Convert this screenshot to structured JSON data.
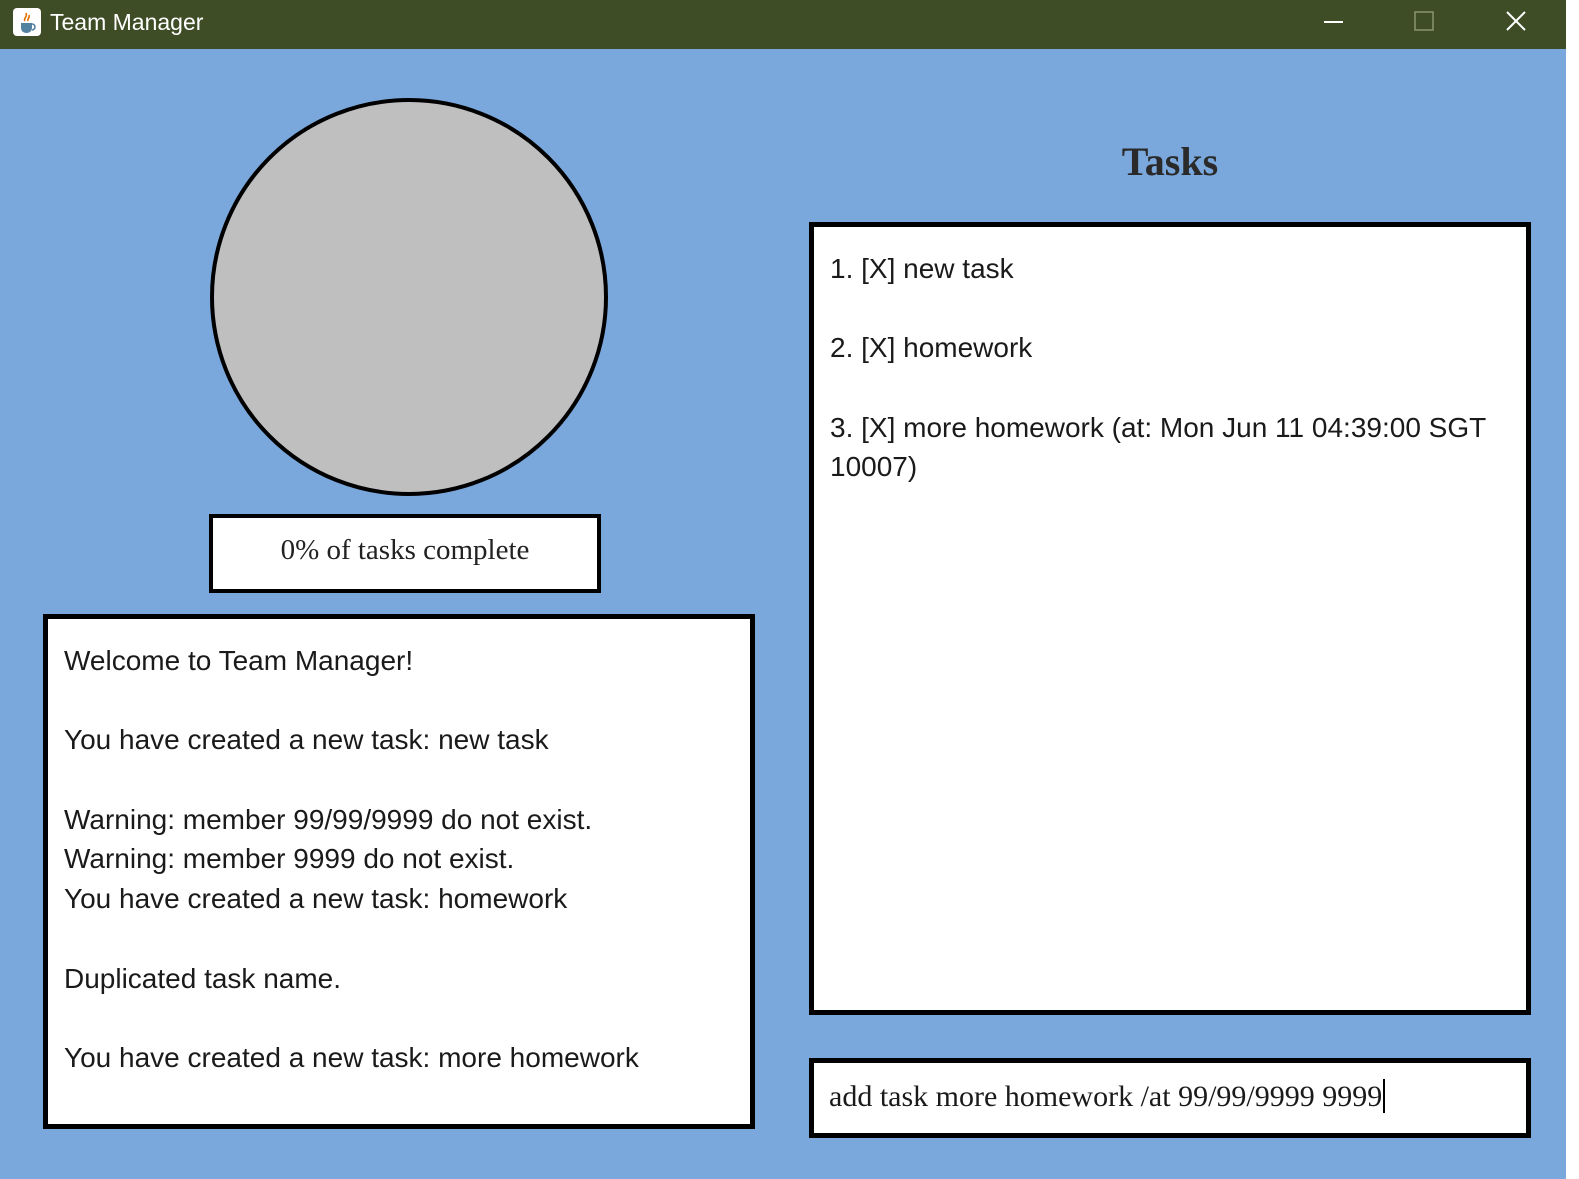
{
  "window": {
    "title": "Team Manager",
    "app_icon": "java-coffee-cup-icon",
    "controls": [
      "minimize-icon",
      "maximize-icon",
      "close-icon"
    ],
    "titlebar_color": "#3f4d26",
    "background_color": "#7aa8dc"
  },
  "progress": {
    "percent": 0,
    "label": "0% of tasks complete",
    "ring_color": "#bfbfbf"
  },
  "log": {
    "lines": [
      "Welcome to Team Manager!",
      "",
      "You have created a new task: new task",
      "",
      "Warning: member 99/99/9999 do not exist.",
      "Warning: member 9999 do not exist.",
      "You have created a new task: homework",
      "",
      "Duplicated task name.",
      "",
      "You have created a new task: more homework"
    ]
  },
  "tasks": {
    "heading": "Tasks",
    "items": [
      "1. [X] new task",
      "2. [X] homework",
      "3. [X] more homework (at: Mon Jun 11 04:39:00 SGT 10007)"
    ]
  },
  "command": {
    "value": "add task more homework /at 99/99/9999 9999"
  }
}
